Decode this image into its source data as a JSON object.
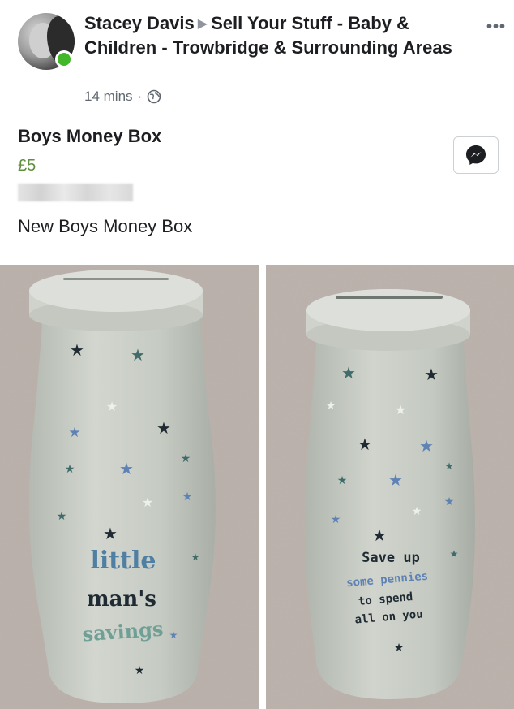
{
  "post": {
    "author": "Stacey Davis",
    "group": "Sell Your Stuff -  Baby & Children  - Trowbridge & Surrounding Areas",
    "time": "14 mins",
    "separator": "·",
    "more_icon": "more-horizontal-icon",
    "privacy_icon": "globe-icon"
  },
  "listing": {
    "title": "Boys Money Box",
    "price": "£5",
    "description": "New Boys Money Box",
    "message_icon": "messenger-icon"
  },
  "photos": [
    {
      "name": "photo-left",
      "text_lines": [
        "little",
        "man's",
        "savings"
      ]
    },
    {
      "name": "photo-right",
      "text_lines": [
        "Save up",
        "some pennies",
        "to spend",
        "all on you"
      ]
    }
  ],
  "colors": {
    "price": "#5e8e3e",
    "online": "#42b72a",
    "text_primary": "#1c1e21",
    "text_secondary": "#606770",
    "money_box": "#c9cec6",
    "carpet": "#b7aca6"
  }
}
